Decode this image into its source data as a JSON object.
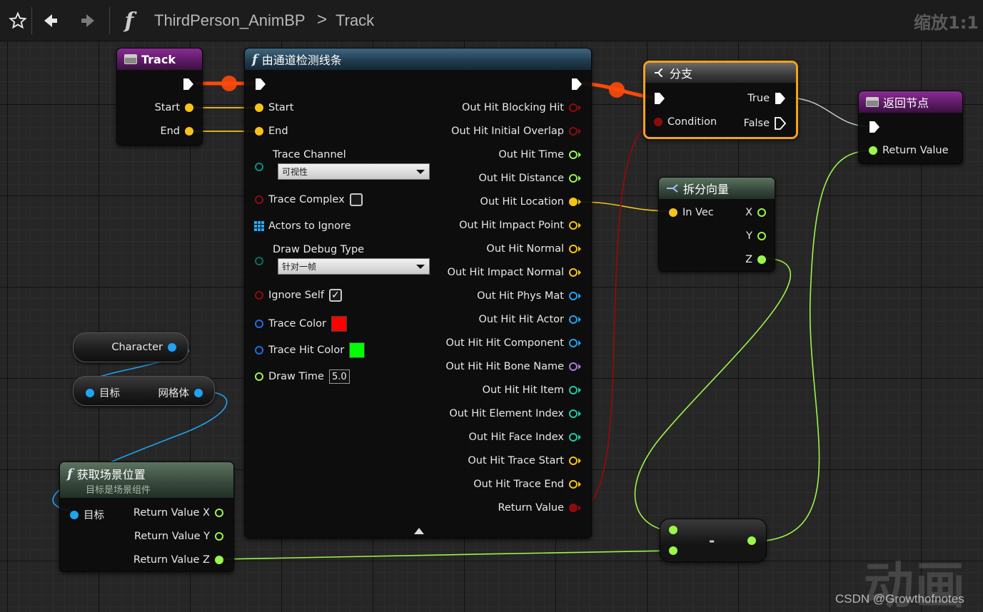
{
  "toolbar": {
    "breadcrumb_graph": "ThirdPerson_AnimBP",
    "breadcrumb_separator": ">",
    "breadcrumb_function": "Track",
    "zoom_label": "缩放1:1",
    "icons": [
      "star-icon",
      "back-arrow-icon",
      "forward-arrow-icon",
      "function-icon"
    ]
  },
  "colors": {
    "exec_wire": "#ff4a0a",
    "vector_pin": "#f6c318",
    "bool_pin": "#8f0b0b",
    "float_pin": "#9cf54a",
    "object_pin": "#1ea4f0",
    "struct_pin": "#0a8f8f",
    "selected_outline": "#f5a21b"
  },
  "track_entry": {
    "title": "Track",
    "pins": [
      "Start",
      "End"
    ]
  },
  "trace_node": {
    "title": "由通道检测线条",
    "inputs": {
      "start": "Start",
      "end": "End",
      "trace_channel": "Trace Channel",
      "trace_channel_value": "可视性",
      "trace_complex": "Trace Complex",
      "actors_to_ignore": "Actors to Ignore",
      "draw_debug_type": "Draw Debug Type",
      "draw_debug_value": "针对一帧",
      "ignore_self": "Ignore Self",
      "ignore_self_check": "✓",
      "trace_color": "Trace Color",
      "trace_color_value": "#ff0000",
      "trace_hit_color": "Trace Hit Color",
      "trace_hit_color_value": "#00ff00",
      "draw_time": "Draw Time",
      "draw_time_value": "5.0"
    },
    "outputs": [
      "Out Hit Blocking Hit",
      "Out Hit Initial Overlap",
      "Out Hit Time",
      "Out Hit Distance",
      "Out Hit Location",
      "Out Hit Impact Point",
      "Out Hit Normal",
      "Out Hit Impact Normal",
      "Out Hit Phys Mat",
      "Out Hit Hit Actor",
      "Out Hit Hit Component",
      "Out Hit Hit Bone Name",
      "Out Hit Hit Item",
      "Out Hit Element Index",
      "Out Hit Face Index",
      "Out Hit Trace Start",
      "Out Hit Trace End",
      "Return Value"
    ],
    "output_pin_colors": [
      "#8f0b0b",
      "#8f0b0b",
      "#9cf54a",
      "#9cf54a",
      "#f6c318",
      "#f6c318",
      "#f6c318",
      "#f6c318",
      "#1ea4f0",
      "#1ea4f0",
      "#1ea4f0",
      "#b07ad9",
      "#20c9a3",
      "#20c9a3",
      "#20c9a3",
      "#f6c318",
      "#f6c318",
      "#8f0b0b"
    ],
    "output_pin_hollow": [
      true,
      true,
      true,
      true,
      false,
      true,
      true,
      true,
      true,
      true,
      true,
      true,
      true,
      true,
      true,
      true,
      true,
      false
    ]
  },
  "branch_node": {
    "title": "分支",
    "condition": "Condition",
    "true": "True",
    "false": "False"
  },
  "return_node": {
    "title": "返回节点",
    "return_value": "Return Value"
  },
  "break_vector_node": {
    "title": "拆分向量",
    "input": "In Vec",
    "outputs": [
      "X",
      "Y",
      "Z"
    ]
  },
  "character_node": {
    "label": "Character"
  },
  "mesh_node": {
    "target": "目标",
    "output": "网格体"
  },
  "world_location_node": {
    "title": "获取场景位置",
    "subtitle": "目标是场景组件",
    "target": "目标",
    "outputs": [
      "Return Value X",
      "Return Value Y",
      "Return Value Z"
    ]
  },
  "subtract_node": {
    "symbol": "-"
  },
  "watermark": {
    "big": "动画",
    "small": "CSDN @Growthofnotes"
  }
}
